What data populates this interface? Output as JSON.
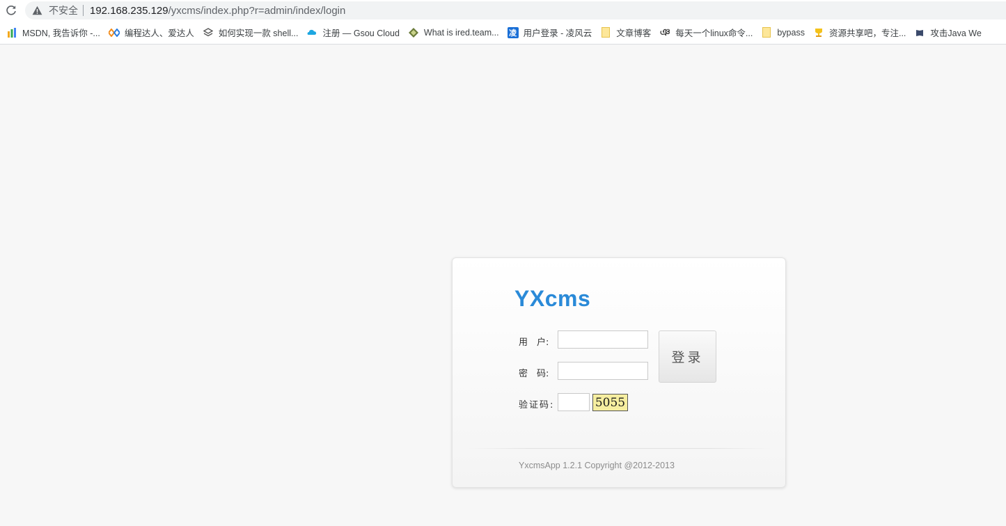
{
  "browser": {
    "security_label": "不安全",
    "url_host": "192.168.235.129",
    "url_path": "/yxcms/index.php?r=admin/index/login"
  },
  "bookmarks": [
    {
      "label": "MSDN, 我告诉你 -...",
      "icon": "msdn-icon"
    },
    {
      "label": "编程达人、爱达人",
      "icon": "diamond-link-icon"
    },
    {
      "label": "如何实现一款 shell...",
      "icon": "layers-icon"
    },
    {
      "label": "注册 — Gsou Cloud",
      "icon": "cloud-icon"
    },
    {
      "label": "What is ired.team...",
      "icon": "ired-icon"
    },
    {
      "label": "用户登录 - 凌风云",
      "icon": "lingfeng-icon"
    },
    {
      "label": "文章博客",
      "icon": "folder-icon"
    },
    {
      "label": "每天一个linux命令...",
      "icon": "omega-icon"
    },
    {
      "label": "bypass",
      "icon": "folder-icon"
    },
    {
      "label": "资源共享吧，专注...",
      "icon": "trophy-icon"
    },
    {
      "label": "攻击Java We",
      "icon": "book-icon"
    }
  ],
  "login": {
    "brand": "YXcms",
    "user_label": "用　户:",
    "user_value": "",
    "password_label": "密　码:",
    "password_value": "",
    "captcha_label": "验证码:",
    "captcha_value": "",
    "captcha_image_text": "5055",
    "submit_label": "登录",
    "copyright": "YxcmsApp 1.2.1 Copyright @2012-2013"
  },
  "colors": {
    "brand": "#2a8ad8",
    "page_bg": "#f7f7f7",
    "captcha_bg": "#f6eea0"
  }
}
